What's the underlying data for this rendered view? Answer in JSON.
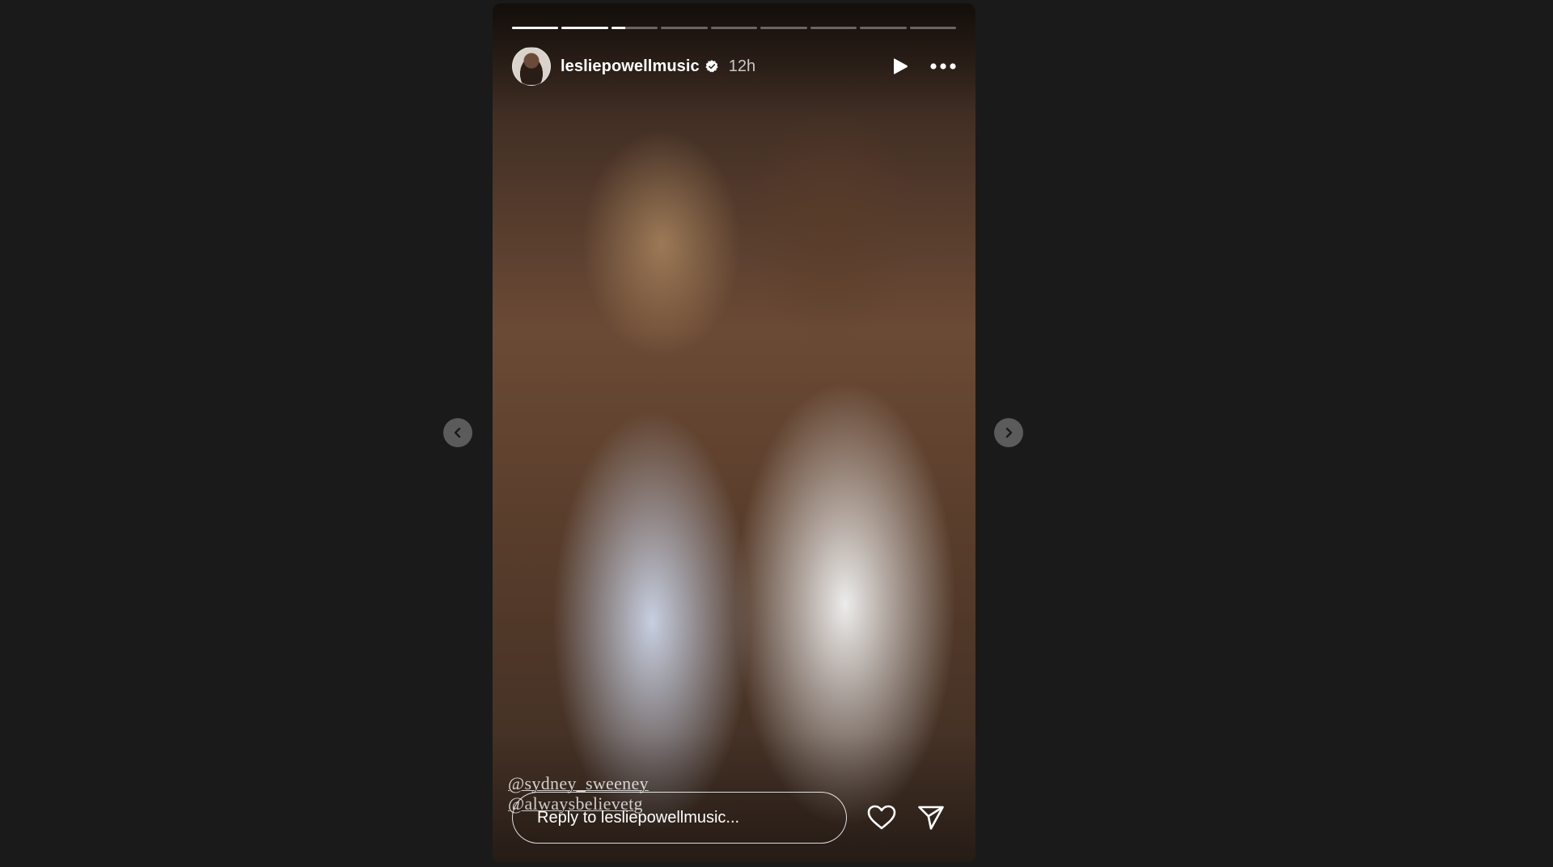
{
  "story": {
    "progress_segments": [
      1,
      1,
      0.3,
      0,
      0,
      0,
      0,
      0,
      0
    ],
    "username": "lesliepowellmusic",
    "verified": true,
    "time": "12h",
    "mentions": [
      "@sydney_sweeney",
      "@alwaysbelievetg"
    ],
    "reply_placeholder": "Reply to lesliepowellmusic..."
  },
  "icons": {
    "play": "play-icon",
    "more": "more-icon",
    "prev": "chevron-left-icon",
    "next": "chevron-right-icon",
    "like": "heart-icon",
    "share": "send-icon",
    "verified": "verified-badge-icon"
  },
  "colors": {
    "background": "#1a1a1a",
    "nav_button": "#5b5b5b",
    "text": "#ffffff"
  }
}
